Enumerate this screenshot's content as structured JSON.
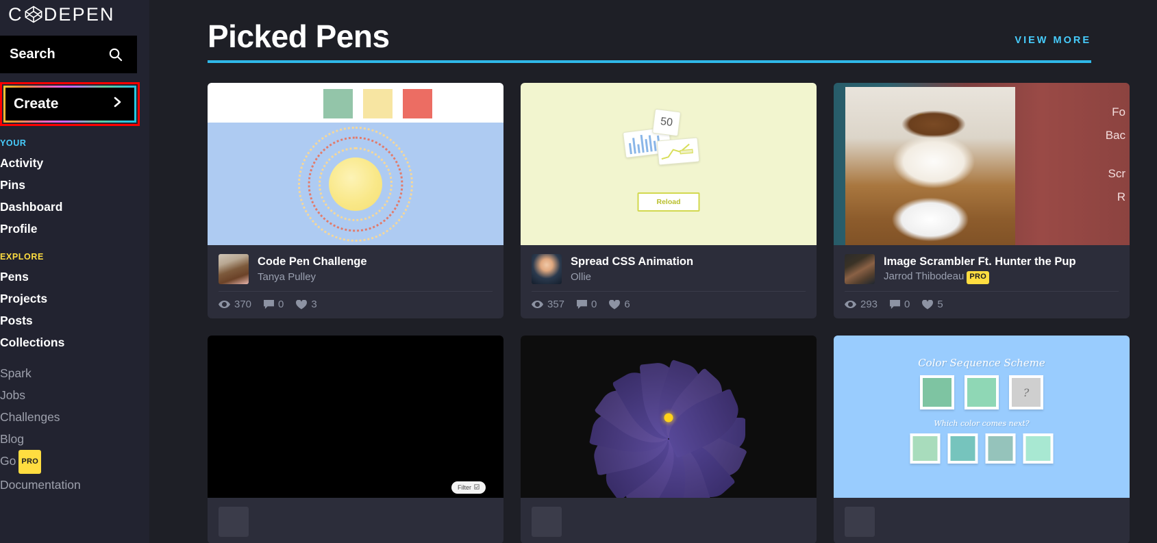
{
  "brand": {
    "logo_text": "CODEPEN",
    "logo_left": "C",
    "logo_right": "DEPEN"
  },
  "sidebar": {
    "search": {
      "label": "Search",
      "icon": "search-icon"
    },
    "create": {
      "label": "Create",
      "chevron": "❯",
      "icon": "chevron-right-icon"
    },
    "your_heading": "YOUR",
    "your_items": [
      {
        "label": "Activity"
      },
      {
        "label": "Pins"
      },
      {
        "label": "Dashboard"
      },
      {
        "label": "Profile"
      }
    ],
    "explore_heading": "EXPLORE",
    "explore_items": [
      {
        "label": "Pens"
      },
      {
        "label": "Projects"
      },
      {
        "label": "Posts"
      },
      {
        "label": "Collections"
      }
    ],
    "secondary_items": [
      {
        "label": "Spark",
        "badge": ""
      },
      {
        "label": "Jobs",
        "badge": ""
      },
      {
        "label": "Challenges",
        "badge": ""
      },
      {
        "label": "Blog",
        "badge": ""
      },
      {
        "label": "Go",
        "badge": "PRO"
      },
      {
        "label": "Documentation",
        "badge": ""
      }
    ]
  },
  "header": {
    "title": "Picked Pens",
    "view_more": "VIEW MORE",
    "accent_color": "#2fb8e8"
  },
  "cards": [
    {
      "title": "Code Pen Challenge",
      "author": "Tanya Pulley",
      "pro": "",
      "views": "370",
      "comments": "0",
      "hearts": "3",
      "preview": "sun-rings",
      "swatches": [
        "#93c5a9",
        "#f7e5a2",
        "#ec6d63"
      ],
      "sky_color": "#aecbf2",
      "sun_color": "#f9e889"
    },
    {
      "title": "Spread CSS Animation",
      "author": "Ollie",
      "pro": "",
      "views": "357",
      "comments": "0",
      "hearts": "6",
      "preview": "spread-cards",
      "counter": "50",
      "button_label": "Reload",
      "bg_color": "#f2f5cf"
    },
    {
      "title": "Image Scrambler Ft. Hunter the Pup",
      "author": "Jarrod Thibodeau",
      "pro": "PRO",
      "views": "293",
      "comments": "0",
      "hearts": "5",
      "preview": "dog-photo",
      "side_lines": [
        "Fo",
        "Bac",
        "Scr",
        "R"
      ]
    },
    {
      "title": "",
      "author": "",
      "pro": "",
      "views": "",
      "comments": "",
      "hearts": "",
      "preview": "black-filter",
      "filter_label": "Filter"
    },
    {
      "title": "",
      "author": "",
      "pro": "",
      "views": "",
      "comments": "",
      "hearts": "",
      "preview": "purple-flower"
    },
    {
      "title": "",
      "author": "",
      "pro": "",
      "views": "",
      "comments": "",
      "hearts": "",
      "preview": "color-sequence",
      "cs_title": "Color Sequence Scheme",
      "cs_subtitle": "Which color comes next?",
      "cs_question": "?",
      "cs_row1": [
        "#7ec4a2",
        "#8fd7b5",
        "#cfcfcf"
      ],
      "cs_row2": [
        "#a8dcbc",
        "#76c4bd",
        "#95c3bb",
        "#a8e8d2"
      ]
    }
  ],
  "icons": {
    "eye": "eye-icon",
    "comment": "comment-icon",
    "heart": "heart-icon"
  }
}
